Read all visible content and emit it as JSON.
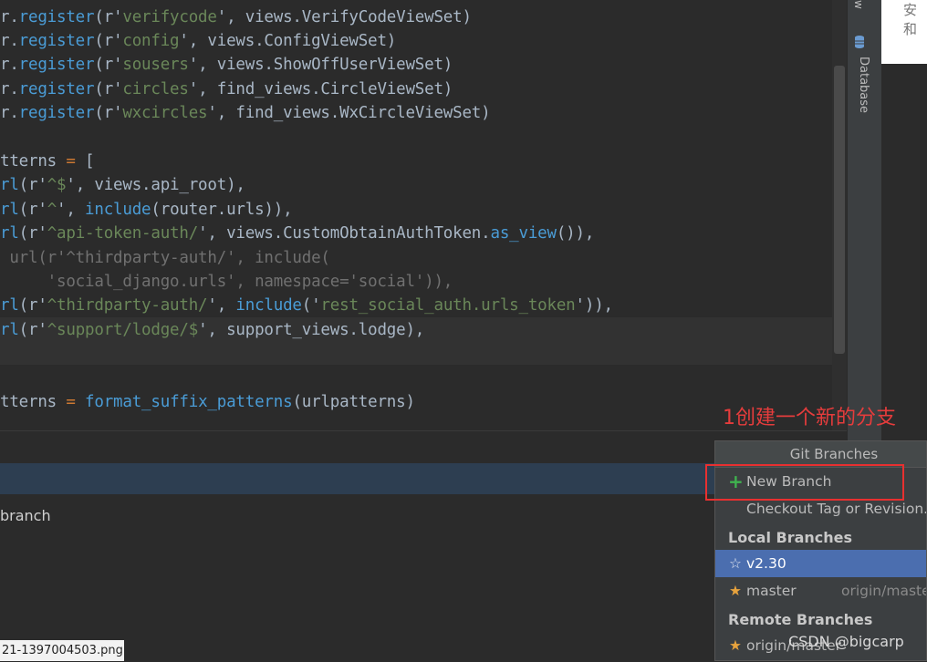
{
  "editor": {
    "lines": [
      {
        "parts": [
          {
            "t": "r.",
            "c": ""
          },
          {
            "t": "register",
            "c": "blue"
          },
          {
            "t": "(r'",
            "c": ""
          },
          {
            "t": "verifycode",
            "c": "str"
          },
          {
            "t": "', views.VerifyCodeViewSet)",
            "c": ""
          }
        ]
      },
      {
        "parts": [
          {
            "t": "r.",
            "c": ""
          },
          {
            "t": "register",
            "c": "blue"
          },
          {
            "t": "(r'",
            "c": ""
          },
          {
            "t": "config",
            "c": "str"
          },
          {
            "t": "', views.ConfigViewSet)",
            "c": ""
          }
        ]
      },
      {
        "parts": [
          {
            "t": "r.",
            "c": ""
          },
          {
            "t": "register",
            "c": "blue"
          },
          {
            "t": "(r'",
            "c": ""
          },
          {
            "t": "sousers",
            "c": "str"
          },
          {
            "t": "', views.ShowOffUserViewSet)",
            "c": ""
          }
        ]
      },
      {
        "parts": [
          {
            "t": "r.",
            "c": ""
          },
          {
            "t": "register",
            "c": "blue"
          },
          {
            "t": "(r'",
            "c": ""
          },
          {
            "t": "circles",
            "c": "str"
          },
          {
            "t": "', find_views.CircleViewSet)",
            "c": ""
          }
        ]
      },
      {
        "parts": [
          {
            "t": "r.",
            "c": ""
          },
          {
            "t": "register",
            "c": "blue"
          },
          {
            "t": "(r'",
            "c": ""
          },
          {
            "t": "wxcircles",
            "c": "str"
          },
          {
            "t": "', find_views.WxCircleViewSet)",
            "c": ""
          }
        ]
      },
      {
        "parts": [
          {
            "t": "",
            "c": ""
          }
        ]
      },
      {
        "parts": [
          {
            "t": "tterns ",
            "c": ""
          },
          {
            "t": "=",
            "c": "pink"
          },
          {
            "t": " [",
            "c": ""
          }
        ]
      },
      {
        "parts": [
          {
            "t": "rl",
            "c": "blue"
          },
          {
            "t": "(r'",
            "c": ""
          },
          {
            "t": "^$",
            "c": "str"
          },
          {
            "t": "', views.api_root),",
            "c": ""
          }
        ]
      },
      {
        "parts": [
          {
            "t": "rl",
            "c": "blue"
          },
          {
            "t": "(r'",
            "c": ""
          },
          {
            "t": "^",
            "c": "str"
          },
          {
            "t": "', ",
            "c": ""
          },
          {
            "t": "include",
            "c": "blue"
          },
          {
            "t": "(router.urls)),",
            "c": ""
          }
        ]
      },
      {
        "parts": [
          {
            "t": "rl",
            "c": "blue"
          },
          {
            "t": "(r'",
            "c": ""
          },
          {
            "t": "^api-token-auth/",
            "c": "str"
          },
          {
            "t": "', views.CustomObtainAuthToken.",
            "c": ""
          },
          {
            "t": "as_view",
            "c": "blue"
          },
          {
            "t": "()),",
            "c": ""
          }
        ]
      },
      {
        "parts": [
          {
            "t": " url(r'^thirdparty-auth/', include(",
            "c": "muted"
          }
        ]
      },
      {
        "parts": [
          {
            "t": "     'social_django.urls', namespace='social')),",
            "c": "muted"
          }
        ]
      },
      {
        "parts": [
          {
            "t": "rl",
            "c": "blue"
          },
          {
            "t": "(r'",
            "c": ""
          },
          {
            "t": "^thirdparty-auth/",
            "c": "str"
          },
          {
            "t": "', ",
            "c": ""
          },
          {
            "t": "include",
            "c": "blue"
          },
          {
            "t": "('",
            "c": ""
          },
          {
            "t": "rest_social_auth.urls_token",
            "c": "str"
          },
          {
            "t": "')),",
            "c": ""
          }
        ]
      },
      {
        "parts": [
          {
            "t": "rl",
            "c": "blue"
          },
          {
            "t": "(r'",
            "c": ""
          },
          {
            "t": "^support/lodge/$",
            "c": "str"
          },
          {
            "t": "', support_views.lodge),",
            "c": ""
          }
        ]
      },
      {
        "parts": [
          {
            "t": "",
            "c": ""
          }
        ]
      },
      {
        "parts": [
          {
            "t": "",
            "c": ""
          }
        ]
      },
      {
        "parts": [
          {
            "t": "tterns ",
            "c": ""
          },
          {
            "t": "=",
            "c": "pink"
          },
          {
            "t": " ",
            "c": ""
          },
          {
            "t": "format_suffix_patterns",
            "c": "blue"
          },
          {
            "t": "(urlpatterns)",
            "c": ""
          }
        ]
      }
    ]
  },
  "side": {
    "tool_label_top": "w",
    "database_label": "Database",
    "white_panel_text": "安和"
  },
  "bottom": {
    "branch_text": "branch",
    "status_filename": "21-1397004503.png"
  },
  "annotation": "1创建一个新的分支",
  "popup": {
    "title": "Git Branches",
    "new_branch": "New Branch",
    "checkout": "Checkout Tag or Revision...",
    "local_header": "Local Branches",
    "local": [
      {
        "name": "v2.30",
        "tracking": "",
        "selected": true
      },
      {
        "name": "master",
        "tracking": "origin/master",
        "selected": false
      }
    ],
    "remote_header": "Remote Branches",
    "remote": [
      {
        "name": "origin/master"
      }
    ]
  },
  "watermark": "CSDN @bigcarp",
  "colors": {
    "accent_red": "#e53c3c",
    "selection": "#4b6eaf",
    "plus_green": "#3fb34f",
    "star": "#e8a33d"
  }
}
